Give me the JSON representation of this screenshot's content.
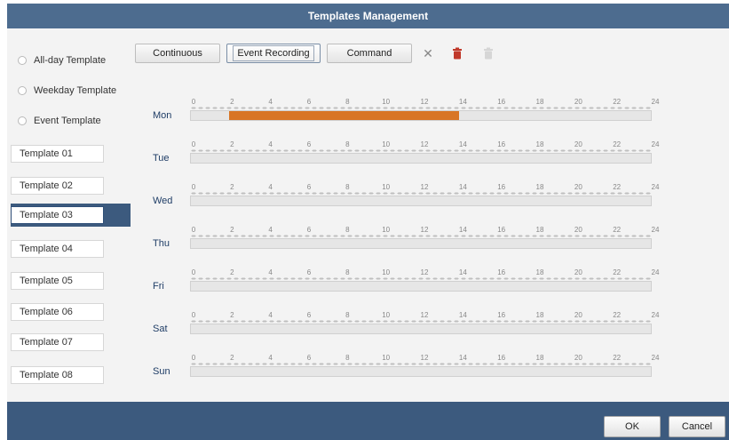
{
  "window": {
    "title": "Templates Management"
  },
  "templates_types": [
    {
      "label": "All-day Template"
    },
    {
      "label": "Weekday Template"
    },
    {
      "label": "Event Template"
    }
  ],
  "templates": [
    {
      "label": "Template 01"
    },
    {
      "label": "Template 02"
    },
    {
      "label": "Template 03"
    },
    {
      "label": "Template 04"
    },
    {
      "label": "Template 05"
    },
    {
      "label": "Template 06"
    },
    {
      "label": "Template 07"
    },
    {
      "label": "Template 08"
    }
  ],
  "selected_template_index": 2,
  "toolbar": {
    "continuous": "Continuous",
    "event_recording": "Event Recording",
    "command": "Command"
  },
  "schedule": {
    "hour_ticks": [
      "0",
      "2",
      "4",
      "6",
      "8",
      "10",
      "12",
      "14",
      "16",
      "18",
      "20",
      "22",
      "24"
    ],
    "days": [
      {
        "label": "Mon",
        "segments": [
          {
            "start": 2,
            "end": 14
          }
        ]
      },
      {
        "label": "Tue",
        "segments": []
      },
      {
        "label": "Wed",
        "segments": []
      },
      {
        "label": "Thu",
        "segments": []
      },
      {
        "label": "Fri",
        "segments": []
      },
      {
        "label": "Sat",
        "segments": []
      },
      {
        "label": "Sun",
        "segments": []
      }
    ],
    "segment_color": "#d87525"
  },
  "footer": {
    "ok": "OK",
    "cancel": "Cancel"
  },
  "colors": {
    "header": "#4d6c8f",
    "footer": "#3c5a7e",
    "selection": "#3c5a7e"
  }
}
